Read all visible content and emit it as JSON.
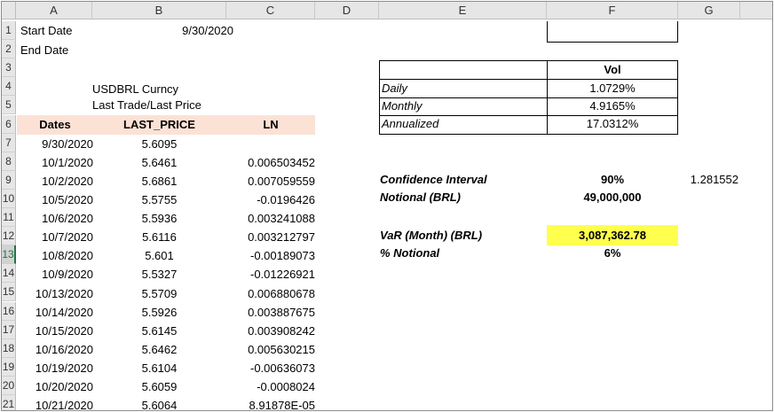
{
  "columns": [
    "A",
    "B",
    "C",
    "D",
    "E",
    "F",
    "G"
  ],
  "rows": [
    "1",
    "2",
    "3",
    "4",
    "5",
    "6",
    "7",
    "8",
    "9",
    "10",
    "11",
    "12",
    "13",
    "14",
    "15",
    "16",
    "17",
    "18",
    "19",
    "20",
    "21"
  ],
  "row_labels": {
    "r1": "Start Date",
    "r2": "End Date",
    "start_date": "9/30/2020",
    "r4": "USDBRL Curncy",
    "r5": "Last Trade/Last Price"
  },
  "table_headers": {
    "dates": "Dates",
    "last_price": "LAST_PRICE",
    "ln": "LN"
  },
  "table_rows": [
    {
      "date": "9/30/2020",
      "price": "5.6095",
      "ln": ""
    },
    {
      "date": "10/1/2020",
      "price": "5.6461",
      "ln": "0.006503452"
    },
    {
      "date": "10/2/2020",
      "price": "5.6861",
      "ln": "0.007059559"
    },
    {
      "date": "10/5/2020",
      "price": "5.5755",
      "ln": "-0.0196426"
    },
    {
      "date": "10/6/2020",
      "price": "5.5936",
      "ln": "0.003241088"
    },
    {
      "date": "10/7/2020",
      "price": "5.6116",
      "ln": "0.003212797"
    },
    {
      "date": "10/8/2020",
      "price": "5.601",
      "ln": "-0.00189073"
    },
    {
      "date": "10/9/2020",
      "price": "5.5327",
      "ln": "-0.01226921"
    },
    {
      "date": "10/13/2020",
      "price": "5.5709",
      "ln": "0.006880678"
    },
    {
      "date": "10/14/2020",
      "price": "5.5926",
      "ln": "0.003887675"
    },
    {
      "date": "10/15/2020",
      "price": "5.6145",
      "ln": "0.003908242"
    },
    {
      "date": "10/16/2020",
      "price": "5.6462",
      "ln": "0.005630215"
    },
    {
      "date": "10/19/2020",
      "price": "5.6104",
      "ln": "-0.00636073"
    },
    {
      "date": "10/20/2020",
      "price": "5.6059",
      "ln": "-0.0008024"
    },
    {
      "date": "10/21/2020",
      "price": "5.6064",
      "ln": "8.91878E-05"
    }
  ],
  "vol_table": {
    "header": "Vol",
    "rows": [
      {
        "label": "Daily",
        "value": "1.0729%"
      },
      {
        "label": "Monthly",
        "value": "4.9165%"
      },
      {
        "label": "Annualized",
        "value": "17.0312%"
      }
    ]
  },
  "metrics": {
    "confidence_label": "Confidence Interval",
    "confidence_value": "90%",
    "z_value": "1.281552",
    "notional_label": "Notional (BRL)",
    "notional_value": "49,000,000",
    "var_label": "VaR (Month) (BRL)",
    "var_value": "3,087,362.78",
    "pct_label": "% Notional",
    "pct_value": "6%"
  },
  "colors": {
    "header_band": "#fbe2d5",
    "highlight": "#ffff4d",
    "active_row": "#217346"
  },
  "active_row": "13"
}
